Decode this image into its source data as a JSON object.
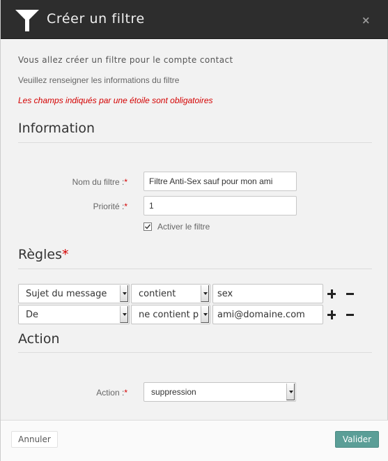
{
  "dialog": {
    "title": "Créer un filtre",
    "close_label": "×"
  },
  "intro": {
    "line1": "Vous allez créer un filtre pour le compte contact",
    "line2": "Veuillez renseigner les informations du filtre",
    "required_notice": "Les champs indiqués par une étoile sont obligatoires"
  },
  "information": {
    "heading": "Information",
    "name_label": "Nom du filtre :",
    "name_value": "Filtre Anti-Sex sauf pour mon ami",
    "priority_label": "Priorité :",
    "priority_value": "1",
    "activate_label": "Activer le filtre",
    "activate_checked": true,
    "required_mark": "*"
  },
  "rules": {
    "heading": "Règles",
    "required_mark": "*",
    "items": [
      {
        "field": "Sujet du message",
        "operator": "contient",
        "value": "sex"
      },
      {
        "field": "De",
        "operator": "ne contient p",
        "value": "ami@domaine.com"
      }
    ]
  },
  "action": {
    "heading": "Action",
    "label": "Action :",
    "required_mark": "*",
    "selected": "suppression"
  },
  "footer": {
    "cancel_label": "Annuler",
    "validate_label": "Valider"
  },
  "colors": {
    "titlebar": "#2d2d2d",
    "required": "#d40000",
    "validate_button": "#5b9e97"
  },
  "icons": {
    "title": "filter-funnel-icon",
    "close": "close-icon",
    "add": "plus-icon",
    "remove": "minus-icon",
    "check": "checkmark-icon"
  }
}
